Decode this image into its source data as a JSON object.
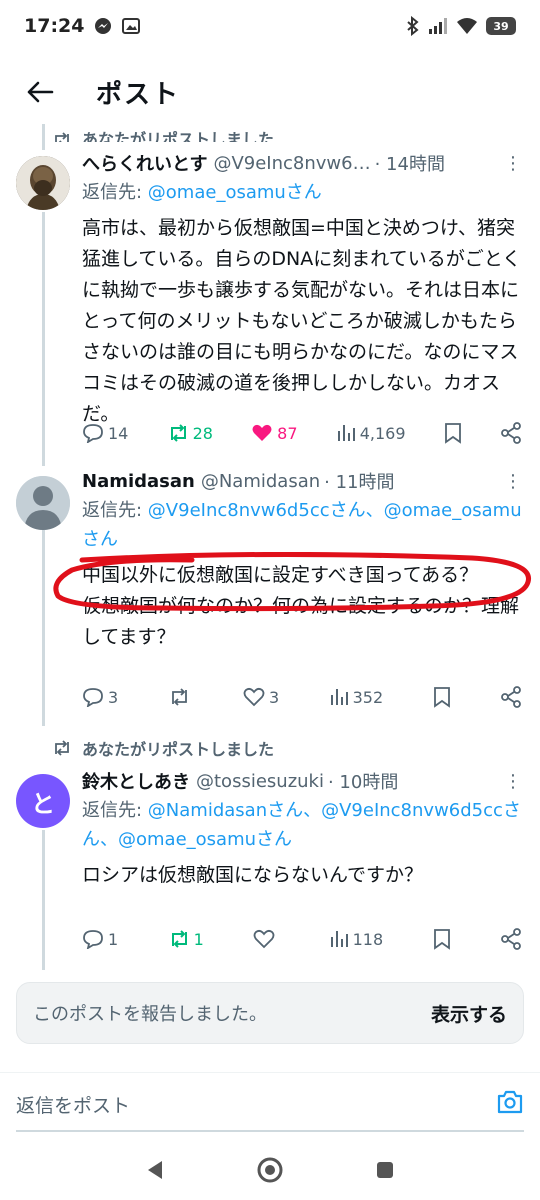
{
  "status_bar": {
    "time": "17:24",
    "battery": "39"
  },
  "header": {
    "title": "ポスト"
  },
  "reposted_top": {
    "text": "あなたがリポストしました"
  },
  "tweet1": {
    "name": "へらくれいとす",
    "handle": "@V9eInc8nvw6…",
    "time": "· 14時間",
    "reply_prefix": "返信先: ",
    "reply_mentions": "@omae_osamuさん",
    "text": "高市は、最初から仮想敵国=中国と決めつけ、猪突猛進している。自らのDNAに刻まれているがごとくに執拗で一歩も譲歩する気配がない。それは日本にとって何のメリットもないどころか破滅しかもたらさないのは誰の目にも明らかなのにだ。なのにマスコミはその破滅の道を後押ししかしない。カオスだ。",
    "replies": "14",
    "reposts": "28",
    "likes": "87",
    "views": "4,169"
  },
  "tweet2": {
    "name": "Namidasan",
    "handle": "@Namidasan",
    "time": "· 11時間",
    "reply_prefix": "返信先: ",
    "reply_mentions": "@V9eInc8nvw6d5ccさん、@omae_osamuさん",
    "text": "中国以外に仮想敵国に設定すべき国ってある？\n仮想敵国が何なのか？何の為に設定するのか？理解してます？",
    "replies": "3",
    "reposts": "",
    "likes": "3",
    "views": "352"
  },
  "reposted_mid": {
    "text": "あなたがリポストしました"
  },
  "tweet3": {
    "avatar_letter": "と",
    "name": "鈴木としあき",
    "handle": "@tossiesuzuki",
    "time": "· 10時間",
    "reply_prefix": "返信先: ",
    "reply_mentions": "@Namidasanさん、@V9eInc8nvw6d5ccさん、@omae_osamuさん",
    "text": "ロシアは仮想敵国にならないんですか？",
    "replies": "1",
    "reposts": "1",
    "likes": "",
    "views": "118"
  },
  "report": {
    "message": "このポストを報告しました。",
    "show_label": "表示する"
  },
  "reply_bar": {
    "placeholder": "返信をポスト"
  },
  "colors": {
    "accent": "#1d9bf0",
    "repost_green": "#00ba7c",
    "like_pink": "#f91880",
    "annotation_red": "#e0101a"
  }
}
